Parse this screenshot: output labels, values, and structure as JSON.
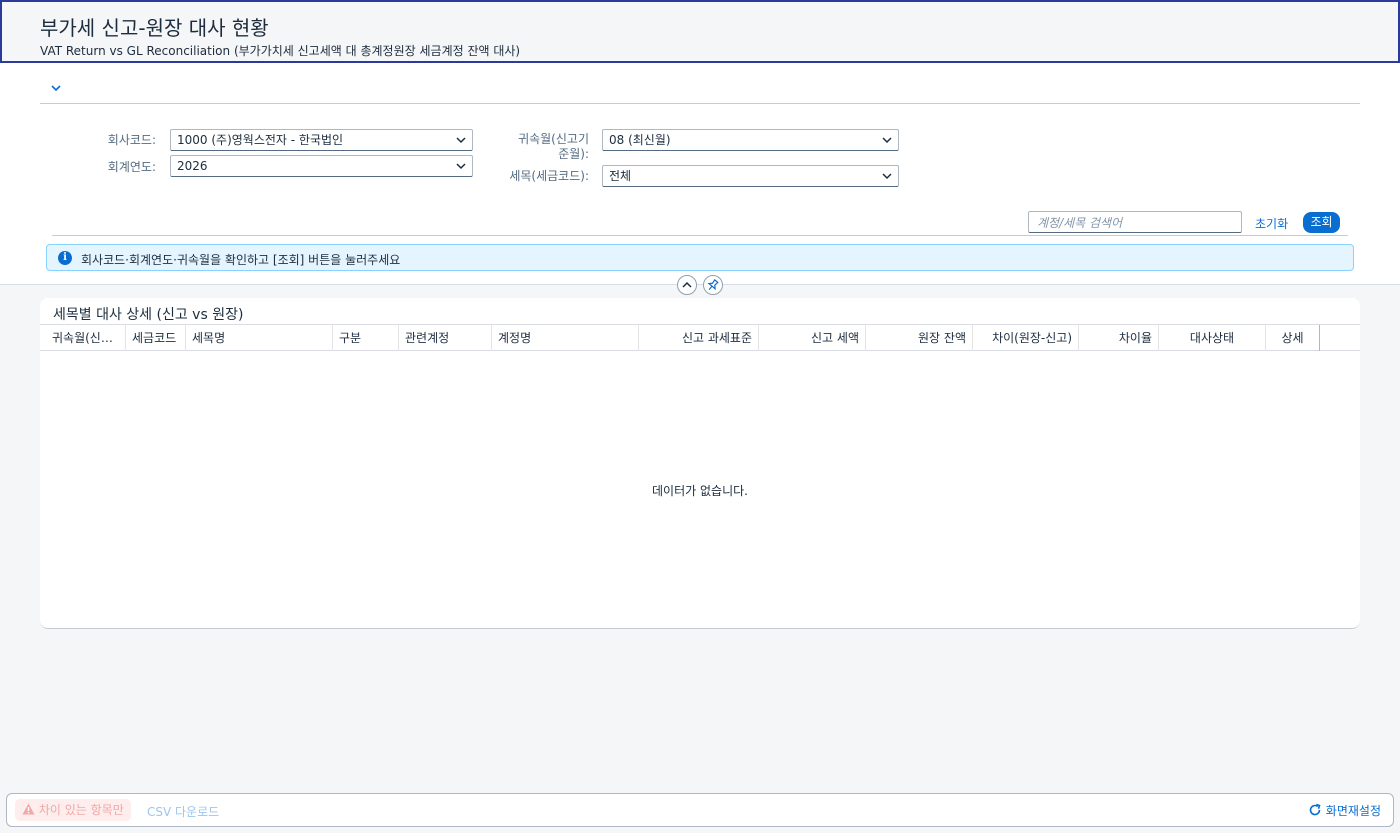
{
  "header": {
    "title": "부가세 신고-원장 대사 현황",
    "subtitle": "VAT Return vs GL Reconciliation (부가가치세 신고세액 대 총계정원장 세금계정 잔액 대사)"
  },
  "filters": {
    "company": {
      "label": "회사코드:",
      "value": "1000 (주)영웍스전자 - 한국법인"
    },
    "fiscal_year": {
      "label": "회계연도:",
      "value": "2026"
    },
    "period": {
      "label_line1": "귀속월(신고기",
      "label_line2": "준월):",
      "value": "08 (최신월)"
    },
    "tax_item": {
      "label": "세목(세금코드):",
      "value": "전체"
    }
  },
  "toolbar": {
    "search_placeholder": "계정/세목 검색어",
    "reset_label": "초기화",
    "go_label": "조회"
  },
  "info_strip": {
    "text": "회사코드·회계연도·귀속월을 확인하고 [조회] 버튼을 눌러주세요"
  },
  "table": {
    "title": "세목별 대사 상세 (신고 vs 원장)",
    "columns": [
      "귀속월(신고기준월)",
      "세금코드",
      "세목명",
      "구분",
      "관련계정",
      "계정명",
      "신고 과세표준",
      "신고 세액",
      "원장 잔액",
      "차이(원장-신고)",
      "차이율",
      "대사상태",
      "상세"
    ],
    "no_data_text": "데이터가 없습니다."
  },
  "footer": {
    "diff_only_label": "차이 있는 항목만",
    "csv_label": "CSV 다운로드",
    "reset_view_label": "화면재설정"
  },
  "colors": {
    "brand": "#0a6ed1",
    "title_border": "#2b3a9c"
  },
  "icons": [
    "chevron-down-icon",
    "info-icon",
    "chevron-up-icon",
    "pin-icon",
    "warning-icon",
    "refresh-icon"
  ]
}
